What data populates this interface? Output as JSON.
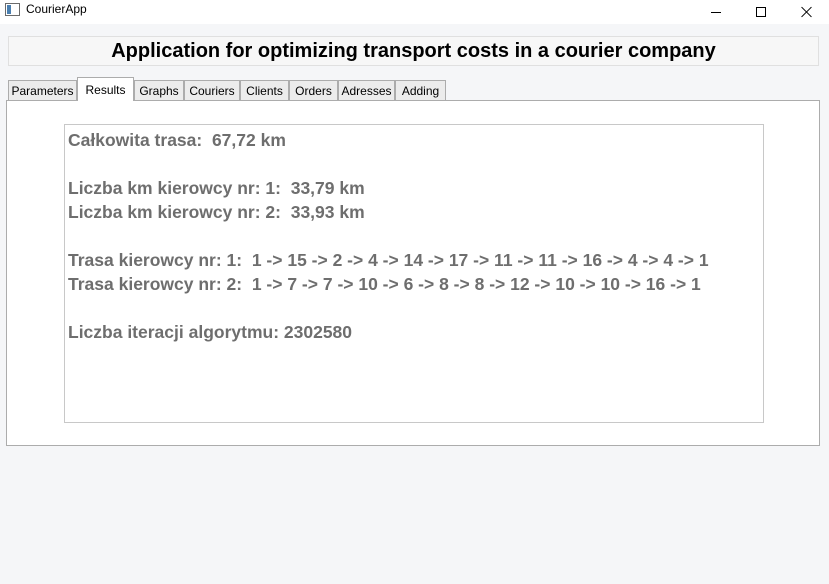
{
  "window": {
    "title": "CourierApp"
  },
  "header": {
    "title": "Application for optimizing transport costs in a courier company"
  },
  "tabs": [
    {
      "label": "Parameters"
    },
    {
      "label": "Results",
      "active": true
    },
    {
      "label": "Graphs"
    },
    {
      "label": "Couriers"
    },
    {
      "label": "Clients"
    },
    {
      "label": "Orders"
    },
    {
      "label": "Adresses"
    },
    {
      "label": "Adding"
    }
  ],
  "results": {
    "total_route": "Całkowita trasa:  67,72 km",
    "driver1_km": "Liczba km kierowcy nr: 1:  33,79 km",
    "driver2_km": "Liczba km kierowcy nr: 2:  33,93 km",
    "driver1_route": "Trasa kierowcy nr: 1:  1 -> 15 -> 2 -> 4 -> 14 -> 17 -> 11 -> 11 -> 16 -> 4 -> 4 -> 1",
    "driver2_route": "Trasa kierowcy nr: 2:  1 -> 7 -> 7 -> 10 -> 6 -> 8 -> 8 -> 12 -> 10 -> 10 -> 16 -> 1",
    "iterations": "Liczba iteracji algorytmu: 2302580"
  }
}
